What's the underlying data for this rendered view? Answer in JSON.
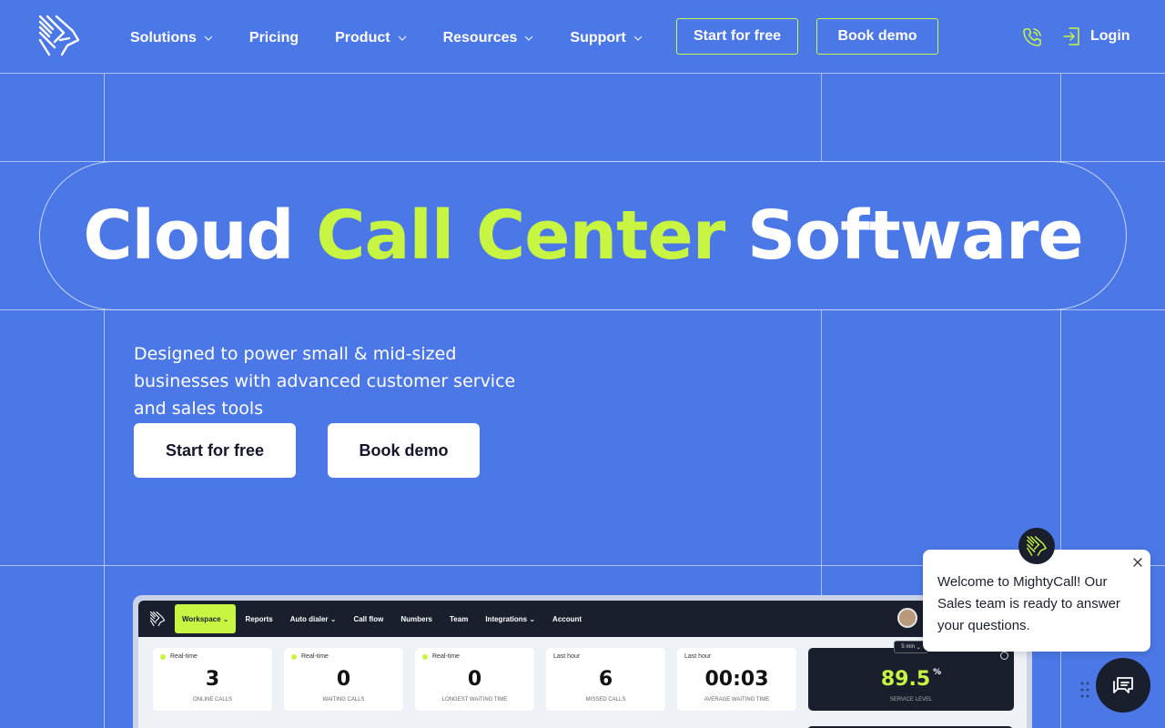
{
  "nav": {
    "items": [
      {
        "label": "Solutions",
        "dropdown": true
      },
      {
        "label": "Pricing",
        "dropdown": false
      },
      {
        "label": "Product",
        "dropdown": true
      },
      {
        "label": "Resources",
        "dropdown": true
      },
      {
        "label": "Support",
        "dropdown": true
      }
    ],
    "start_label": "Start for free",
    "demo_label": "Book demo",
    "login_label": "Login"
  },
  "hero": {
    "title_part1": "Cloud ",
    "title_accent": "Call Center",
    "title_part2": " Software",
    "subtitle": "Designed to power small & mid-sized businesses with advanced customer service and sales tools",
    "cta_start": "Start for free",
    "cta_demo": "Book demo"
  },
  "dashboard": {
    "tabs": [
      "Workspace",
      "Reports",
      "Auto dialer",
      "Call flow",
      "Numbers",
      "Team",
      "Integrations",
      "Account"
    ],
    "cards": [
      {
        "label": "Real-time",
        "value": "3",
        "sub": "ONLINE CALLS"
      },
      {
        "label": "Real-time",
        "value": "0",
        "sub": "WAITING CALLS"
      },
      {
        "label": "Real-time",
        "value": "0",
        "sub": "LONGEST WAITING TIME"
      },
      {
        "label": "Last hour",
        "value": "6",
        "sub": "MISSED CALLS"
      },
      {
        "label": "Last hour",
        "value": "00:03",
        "sub": "AVERAGE WAITING TIME"
      }
    ],
    "service": {
      "value": "89.5",
      "unit": "%",
      "sub": "SERVICE LEVEL",
      "period": "5 min"
    }
  },
  "chat": {
    "message": "Welcome to MightyCall! Our Sales team is ready to answer your questions."
  },
  "colors": {
    "background": "#4b78e6",
    "accent": "#c8f542",
    "dark": "#1a1f2e"
  }
}
